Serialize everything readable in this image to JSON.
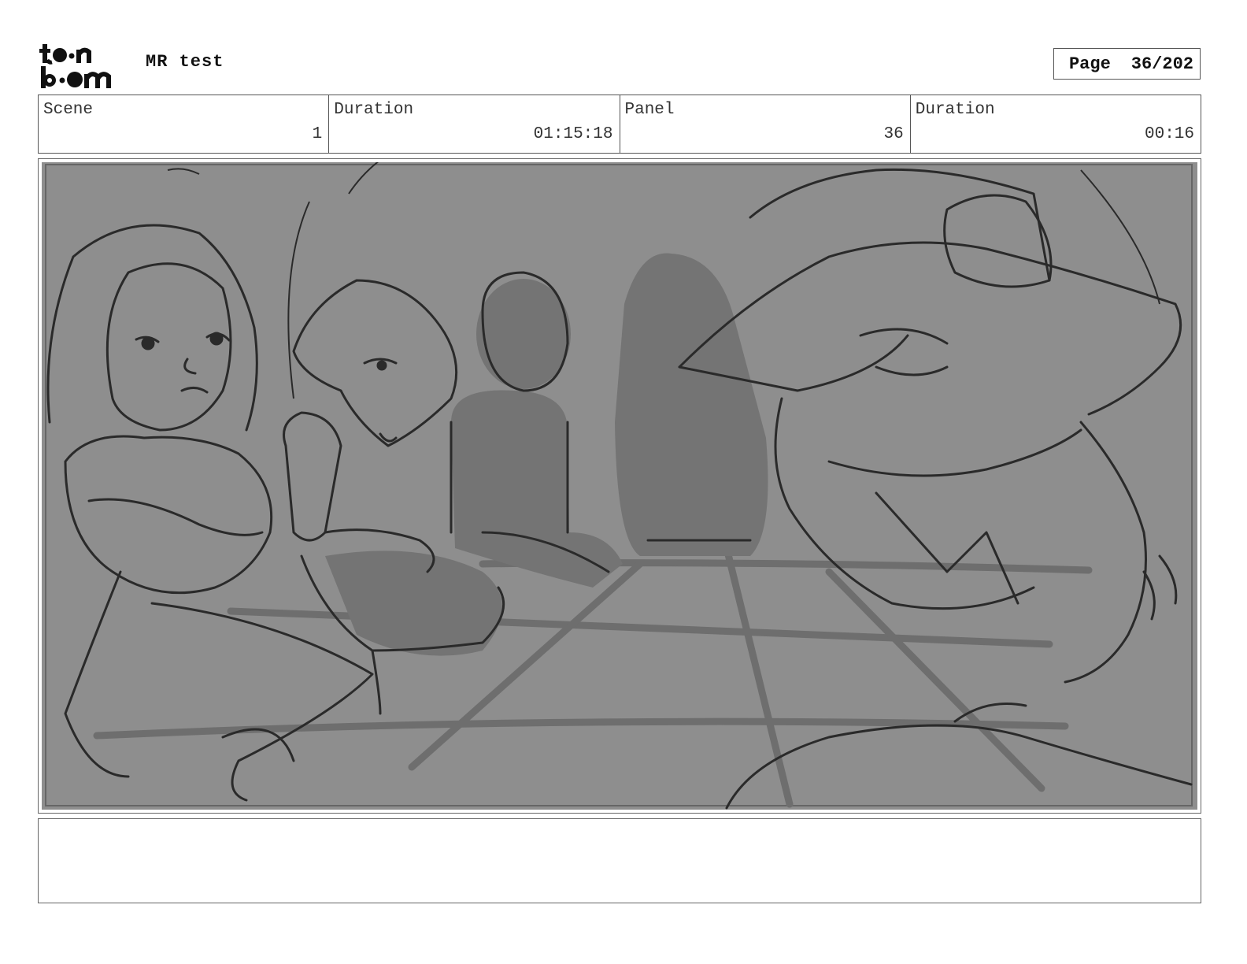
{
  "header": {
    "logo_alt": "toon boom",
    "project_title": "MR test",
    "page_label": "Page",
    "page_number": "36/202"
  },
  "info": {
    "scene_label": "Scene",
    "scene_value": "1",
    "scene_duration_label": "Duration",
    "scene_duration_value": "01:15:18",
    "panel_label": "Panel",
    "panel_value": "36",
    "panel_duration_label": "Duration",
    "panel_duration_value": "00:16"
  },
  "panel": {
    "background_color": "#8e8e8e",
    "line_color": "#2a2a2a",
    "shadow_color": "#707070"
  },
  "notes": {
    "text": ""
  }
}
